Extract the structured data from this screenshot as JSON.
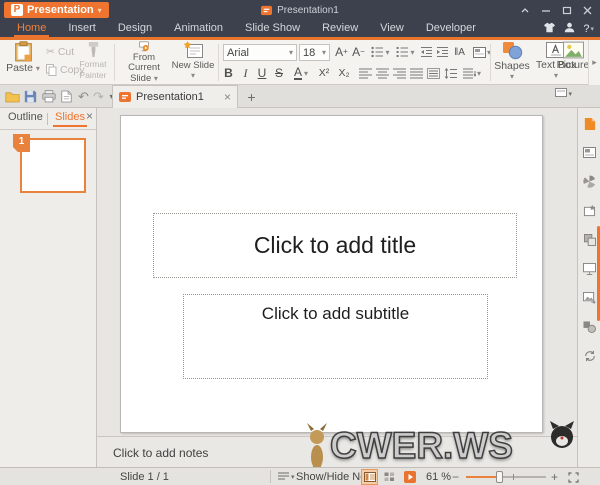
{
  "window": {
    "logo_letter": "P",
    "app_name": "Presentation",
    "doc_title": "Presentation1"
  },
  "menu": {
    "tabs": [
      "Home",
      "Insert",
      "Design",
      "Animation",
      "Slide Show",
      "Review",
      "View",
      "Developer"
    ],
    "active_tab": "Home",
    "help_label": "?"
  },
  "ribbon": {
    "paste": "Paste",
    "cut": "Cut",
    "copy": "Copy",
    "format_painter_line1": "Format",
    "format_painter_line2": "Painter",
    "from_current_line1": "From Current",
    "from_current_line2": "Slide",
    "new_slide": "New Slide",
    "font_name": "Arial",
    "font_size": "18",
    "bold": "B",
    "italic": "I",
    "underline": "U",
    "strikethrough": "S",
    "font_color": "A",
    "grow_font": "A",
    "shrink_font": "A",
    "superscript": "X²",
    "subscript": "X₂",
    "text_direction": "‖A",
    "shapes": "Shapes",
    "text_box": "Text Box",
    "picture": "Picture"
  },
  "doc_tab": {
    "title": "Presentation1"
  },
  "left_panel": {
    "tab_outline": "Outline",
    "tab_slides": "Slides",
    "slide_number": "1"
  },
  "slide": {
    "title_placeholder": "Click to add title",
    "subtitle_placeholder": "Click to add subtitle"
  },
  "notes": {
    "placeholder": "Click to add notes"
  },
  "watermark": {
    "text": "CWER.WS"
  },
  "status": {
    "slide_indicator": "Slide 1 / 1",
    "show_hide_note": "Show/Hide Note",
    "zoom_level": "61 %"
  },
  "glyphs": {
    "caret": "▾",
    "plus": "+",
    "minus": "−",
    "close": "×",
    "cut_icon": "✂",
    "undo": "↶",
    "redo": "↷",
    "expand": "▸"
  },
  "colors": {
    "accent": "#ee7430",
    "titlebar_bg": "#3c414d"
  }
}
